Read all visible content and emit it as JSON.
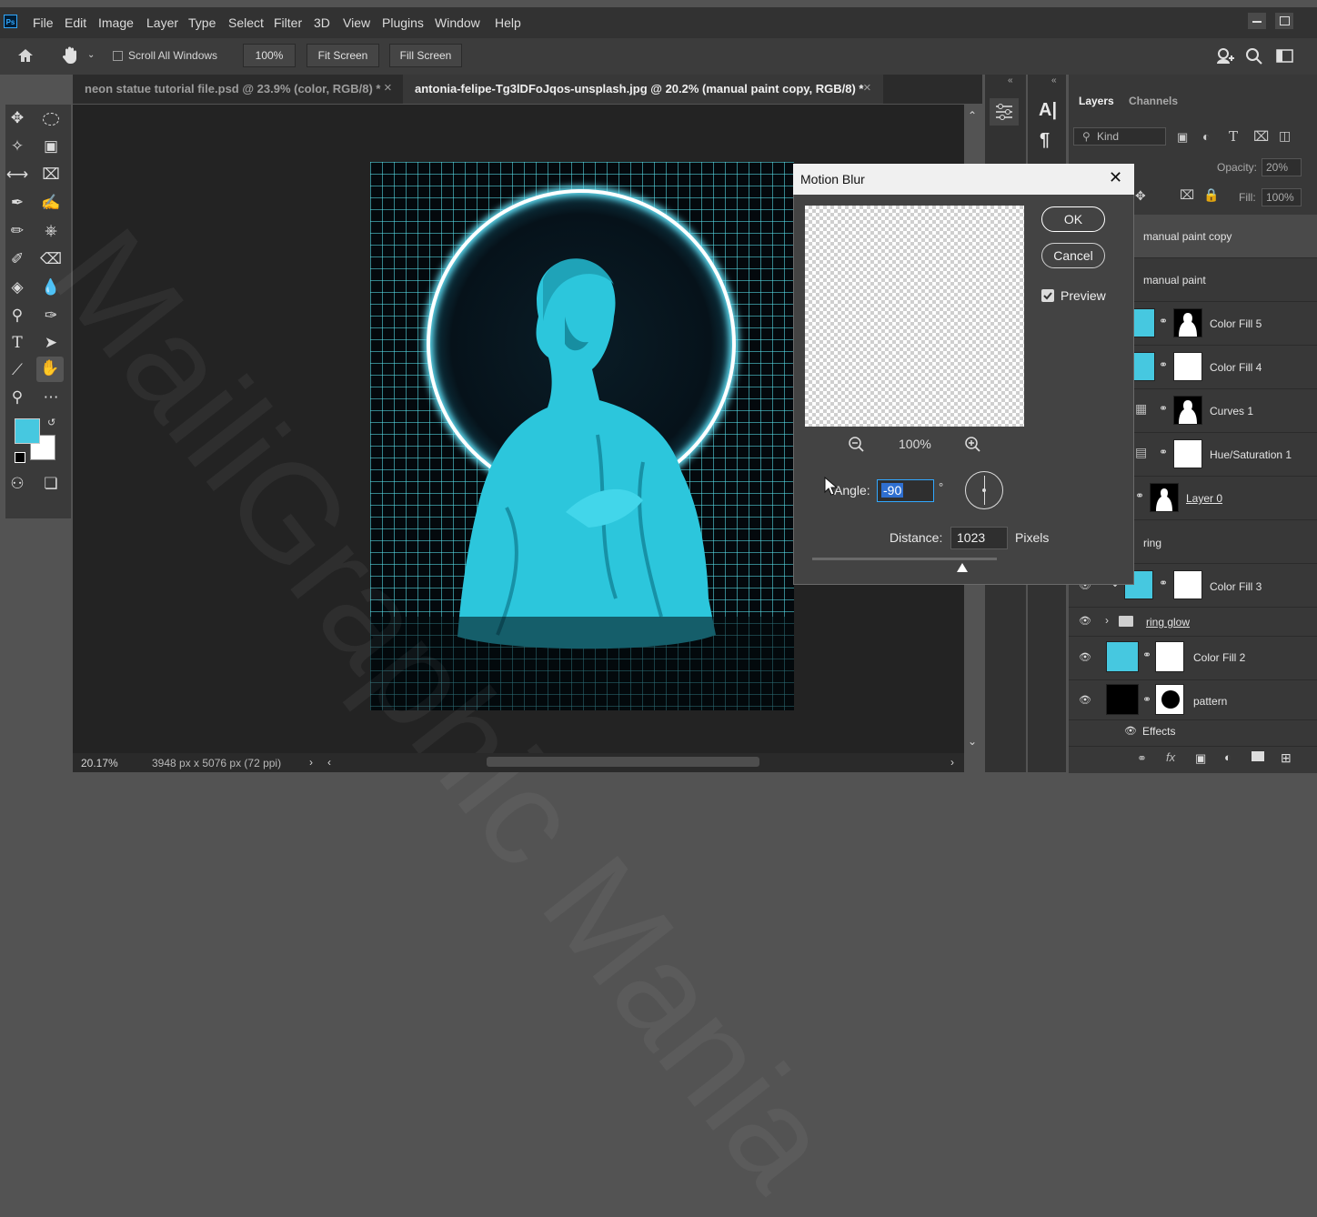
{
  "menu": {
    "logo": "Ps",
    "items": [
      "File",
      "Edit",
      "Image",
      "Layer",
      "Type",
      "Select",
      "Filter",
      "3D",
      "View",
      "Plugins",
      "Window",
      "Help"
    ]
  },
  "options": {
    "scroll_all_windows": "Scroll All Windows",
    "zoom_value": "100%",
    "fit_screen": "Fit Screen",
    "fill_screen": "Fill Screen"
  },
  "tabs": [
    {
      "label": "neon statue tutorial file.psd @ 23.9% (color, RGB/8) *",
      "close": "×"
    },
    {
      "label": "antonia-felipe-Tg3lDFoJqos-unsplash.jpg @ 20.2% (manual paint copy, RGB/8) *",
      "close": "×"
    }
  ],
  "colors": {
    "foreground": "#46c8e0",
    "background": "#ffffff",
    "accent": "#31a8ff",
    "neon": "#3fd9ee"
  },
  "status": {
    "zoom": "20.17%",
    "doc_info": "3948 px x 5076 px (72 ppi)"
  },
  "watermark": "MailiGraphic Mania",
  "dialog": {
    "title": "Motion Blur",
    "ok": "OK",
    "cancel": "Cancel",
    "preview_label": "Preview",
    "preview_checked": true,
    "zoom": "100%",
    "angle_label": "Angle:",
    "angle_value": "-90",
    "angle_unit": "°",
    "distance_label": "Distance:",
    "distance_value": "1023",
    "distance_unit": "Pixels"
  },
  "panel": {
    "tabs": [
      "Layers",
      "Channels"
    ],
    "kind_label": "Kind",
    "opacity_label": "Opacity:",
    "opacity_value": "20%",
    "fill_label": "Fill:",
    "fill_value": "100%",
    "effects_label": "Effects"
  },
  "layers": [
    {
      "name": "manual paint copy"
    },
    {
      "name": "manual paint"
    },
    {
      "name": "Color Fill 5"
    },
    {
      "name": "Color Fill 4"
    },
    {
      "name": "Curves 1"
    },
    {
      "name": "Hue/Saturation 1"
    },
    {
      "name": "Layer 0"
    },
    {
      "name": "ring"
    },
    {
      "name": "Color Fill 3"
    },
    {
      "name": "ring glow"
    },
    {
      "name": "Color Fill 2"
    },
    {
      "name": "pattern"
    }
  ]
}
